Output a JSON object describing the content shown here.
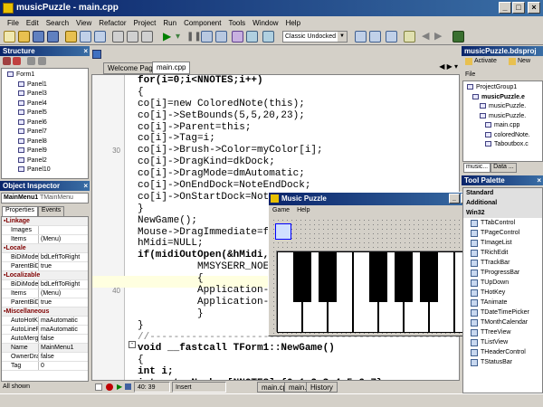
{
  "window": {
    "title": "musicPuzzle - main.cpp"
  },
  "menu": [
    "File",
    "Edit",
    "Search",
    "View",
    "Refactor",
    "Project",
    "Run",
    "Component",
    "Tools",
    "Window",
    "Help"
  ],
  "toolbar": {
    "layout_combo": "Classic Undocked"
  },
  "structure": {
    "title": "Structure",
    "root": "Form1",
    "items": [
      "Panel1",
      "Panel3",
      "Panel4",
      "Panel5",
      "Panel6",
      "Panel7",
      "Panel8",
      "Panel9",
      "Panel2",
      "Panel10"
    ]
  },
  "object_inspector": {
    "title": "Object Inspector",
    "selected": "MainMenu1",
    "selected_type": "TMainMenu",
    "tabs": [
      "Properties",
      "Events"
    ],
    "rows": [
      {
        "cat": "Linkage"
      },
      {
        "k": "Images",
        "v": ""
      },
      {
        "k": "Items",
        "v": "(Menu)"
      },
      {
        "cat": "Locale"
      },
      {
        "k": "BiDiMode",
        "v": "bdLeftToRight"
      },
      {
        "k": "ParentBiDiM",
        "v": "true"
      },
      {
        "cat": "Localizable"
      },
      {
        "k": "BiDiMode",
        "v": "bdLeftToRight"
      },
      {
        "k": "Items",
        "v": "(Menu)"
      },
      {
        "k": "ParentBiDiM",
        "v": "true"
      },
      {
        "cat": "Miscellaneous"
      },
      {
        "k": "AutoHotKey",
        "v": "maAutomatic"
      },
      {
        "k": "AutoLineRe",
        "v": "maAutomatic"
      },
      {
        "k": "AutoMerge",
        "v": "false"
      },
      {
        "k": "Name",
        "v": "MainMenu1"
      },
      {
        "k": "OwnerDraw",
        "v": "false"
      },
      {
        "k": "Tag",
        "v": "0"
      }
    ],
    "footer": "All shown"
  },
  "editor": {
    "tabs": [
      "Welcome Page",
      "main.cpp"
    ],
    "gutter_numbers": [
      {
        "n": "30",
        "line": 6
      },
      {
        "n": "40",
        "line": 18
      }
    ],
    "lines": [
      "for(i=0;i<NNOTES;i++)",
      "{",
      "co[i]=new ColoredNote(this);",
      "co[i]->SetBounds(5,5,20,23);",
      "co[i]->Parent=this;",
      "co[i]->Tag=i;",
      "co[i]->Brush->Color=myColor[i];",
      "co[i]->DragKind=dkDock;",
      "co[i]->DragMode=dmAutomatic;",
      "co[i]->OnEndDock=NoteEndDock;",
      "co[i]->OnStartDock=NoteStartDock;",
      "}",
      "NewGame();",
      "Mouse->DragImmediate=false;",
      "hMidi=NULL;",
      "if(midiOutOpen(&hMidi, 0,",
      "MMSYSERR_NOERROR)",
      "{",
      "Application->",
      "Application->",
      "}",
      "}",
      "//----------------------------------------------------------",
      "void __fastcall TForm1::NewGame()",
      "{",
      "int i;",
      "int notesNumber[NNOTES]={0,1,2,3,4,5,6,7};"
    ],
    "status": {
      "pos": "40: 39",
      "mode": "Insert",
      "tabs": [
        "main.cpp",
        "main.h",
        "History"
      ]
    }
  },
  "form_window": {
    "title": "Music Puzzle",
    "menu": [
      "Game",
      "Help"
    ]
  },
  "project_manager": {
    "title": "musicPuzzle.bdsproj",
    "buttons": [
      "Activate",
      "New"
    ],
    "header": "File",
    "tree": [
      "ProjectGroup1",
      "musicPuzzle.e",
      "musicPuzzle.",
      "musicPuzzle.",
      "main.cpp",
      "coloredNote.",
      "Taboutbox.c"
    ],
    "tabs": [
      "music...",
      "Data ..."
    ]
  },
  "tool_palette": {
    "title": "Tool Palette",
    "items": [
      "Standard",
      "Additional",
      "Win32",
      "TTabControl",
      "TPageControl",
      "TImageList",
      "TRichEdit",
      "TTrackBar",
      "TProgressBar",
      "TUpDown",
      "THotKey",
      "TAnimate",
      "TDateTimePicker",
      "TMonthCalendar",
      "TTreeView",
      "TListView",
      "THeaderControl",
      "TStatusBar"
    ]
  }
}
